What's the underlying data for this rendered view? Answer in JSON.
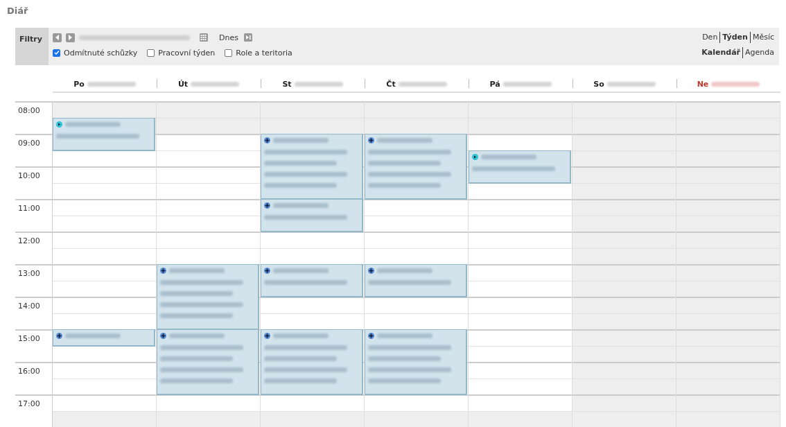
{
  "title": "Diář",
  "filters": {
    "label": "Filtry",
    "today": "Dnes",
    "checkboxes": [
      {
        "label": "Odmítnuté schůzky",
        "checked": true
      },
      {
        "label": "Pracovní týden",
        "checked": false
      },
      {
        "label": "Role a teritoria",
        "checked": false
      }
    ],
    "views": [
      {
        "label": "Den",
        "selected": false
      },
      {
        "label": "Týden",
        "selected": true
      },
      {
        "label": "Měsíc",
        "selected": false
      }
    ],
    "modes": [
      {
        "label": "Kalendář",
        "selected": true
      },
      {
        "label": "Agenda",
        "selected": false
      }
    ]
  },
  "days": [
    {
      "name": "Po",
      "kind": "workday",
      "events": [
        {
          "kind": "teal"
        },
        {
          "kind": "plus"
        }
      ]
    },
    {
      "name": "Út",
      "kind": "workday",
      "events": [
        {
          "kind": "plus"
        },
        {
          "kind": "plus"
        }
      ]
    },
    {
      "name": "St",
      "kind": "workday",
      "events": [
        {
          "kind": "plus"
        },
        {
          "kind": "plus"
        },
        {
          "kind": "plus"
        },
        {
          "kind": "plus"
        }
      ]
    },
    {
      "name": "Čt",
      "kind": "workday",
      "events": [
        {
          "kind": "plus"
        },
        {
          "kind": "plus"
        },
        {
          "kind": "plus"
        }
      ]
    },
    {
      "name": "Pá",
      "kind": "workday",
      "events": [
        {
          "kind": "teal"
        }
      ]
    },
    {
      "name": "So",
      "kind": "saturday"
    },
    {
      "name": "Ne",
      "kind": "sunday"
    }
  ],
  "hours": [
    "08:00",
    "09:00",
    "10:00",
    "11:00",
    "12:00",
    "13:00",
    "14:00",
    "15:00",
    "16:00",
    "17:00"
  ]
}
